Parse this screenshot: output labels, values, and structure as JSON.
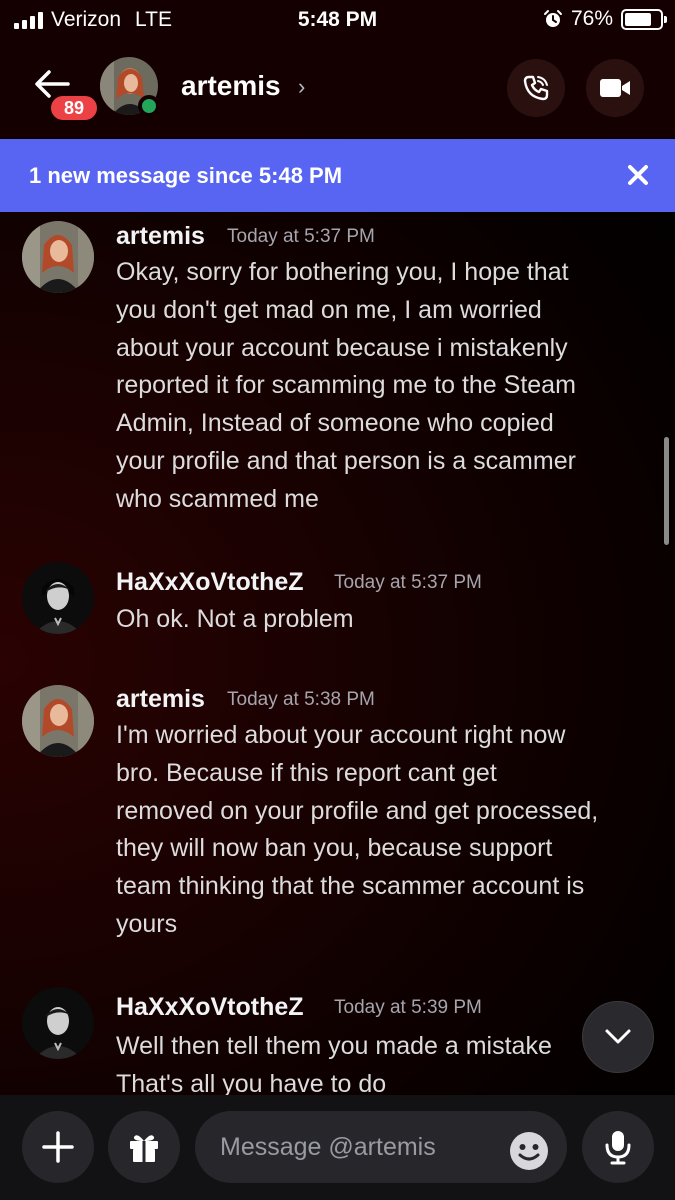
{
  "status_bar": {
    "carrier": "Verizon",
    "network": "LTE",
    "time": "5:48 PM",
    "battery": "76%",
    "battery_level": 0.76
  },
  "header": {
    "unread_count": "89",
    "contact_name": "artemis",
    "chevron": "›",
    "online_color": "#23a55a"
  },
  "banner": {
    "text": "1 new message since 5:48 PM",
    "color": "#5865f2"
  },
  "messages": [
    {
      "author": "artemis",
      "time": "Today at 5:37 PM",
      "lines": [
        "Okay, sorry for bothering you, I hope that",
        "you don't get mad on me, I am worried",
        "about your account because i mistakenly",
        "reported it for scamming me to the Steam",
        "Admin, Instead of someone who copied",
        "your profile and that person is a scammer",
        "who scammed me"
      ]
    },
    {
      "author": "HaXxXoVtotheZ",
      "time": "Today at 5:37 PM",
      "lines": [
        "Oh ok. Not a problem"
      ]
    },
    {
      "author": "artemis",
      "time": "Today at 5:38 PM",
      "lines": [
        "I'm worried about your account right now",
        "bro. Because if this report cant get",
        "removed on your profile and get processed,",
        "they will now ban you, because support",
        "team thinking that the scammer account is",
        "yours"
      ]
    },
    {
      "author": "HaXxXoVtotheZ",
      "time": "Today at 5:39 PM",
      "lines": [
        "Well then tell them you made a mistake",
        "That's all you have to do"
      ]
    }
  ],
  "composer": {
    "placeholder": "Message @artemis"
  },
  "icons": {
    "back": "arrow-left-icon",
    "call": "phone-icon",
    "video": "video-camera-icon",
    "close": "close-icon",
    "jump": "chevron-down-icon",
    "add": "plus-icon",
    "gift": "gift-icon",
    "emoji": "smiley-icon",
    "mic": "microphone-icon"
  }
}
